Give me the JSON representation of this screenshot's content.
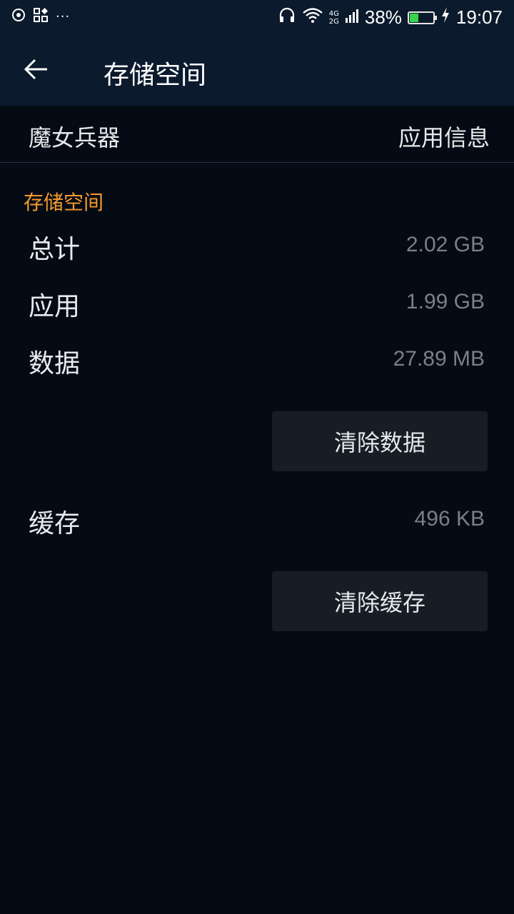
{
  "status_bar": {
    "network_top": "4G",
    "network_bottom": "2G",
    "battery_percent": "38%",
    "battery_level": 0.38,
    "time": "19:07",
    "icons": [
      "sync-icon",
      "apps-icon",
      "more-icon",
      "headset-icon",
      "wifi-icon",
      "signal-icon",
      "battery-icon",
      "charging-icon"
    ]
  },
  "toolbar": {
    "back_icon": "back-arrow-icon",
    "title": "存储空间"
  },
  "app_row": {
    "name": "魔女兵器",
    "info_link": "应用信息"
  },
  "storage": {
    "section_title": "存储空间",
    "items": [
      {
        "label": "总计",
        "value": "2.02 GB"
      },
      {
        "label": "应用",
        "value": "1.99 GB"
      },
      {
        "label": "数据",
        "value": "27.89 MB"
      }
    ],
    "clear_data_label": "清除数据",
    "cache": {
      "label": "缓存",
      "value": "496 KB"
    },
    "clear_cache_label": "清除缓存"
  },
  "colors": {
    "background": "#050b15",
    "toolbar": "#0b1a2c",
    "accent": "#f39a2c",
    "value_text": "#7a8089",
    "button_bg": "#161d25",
    "battery_fill": "#37d34b"
  }
}
